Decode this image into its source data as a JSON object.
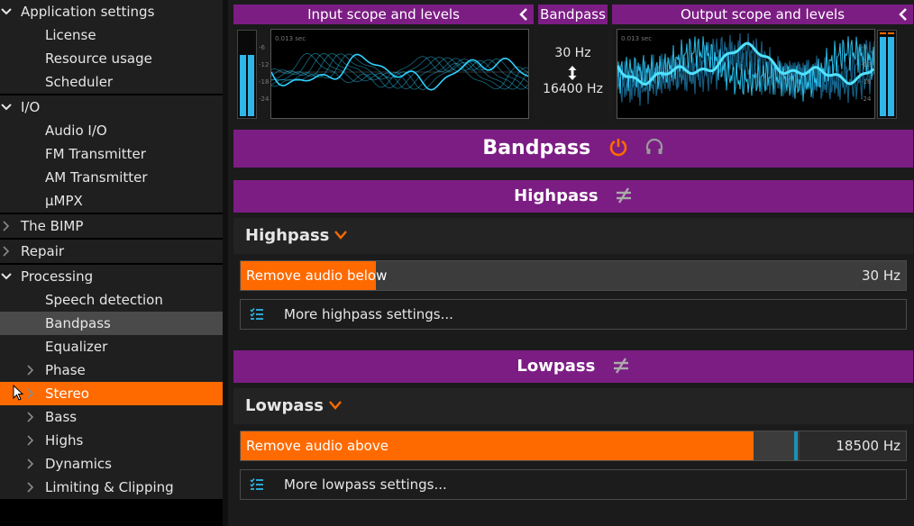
{
  "sidebar": {
    "items": [
      {
        "label": "Application settings",
        "level": 0,
        "chevron": "down"
      },
      {
        "label": "License",
        "level": 1
      },
      {
        "label": "Resource usage",
        "level": 1
      },
      {
        "label": "Scheduler",
        "level": 1
      },
      {
        "label": "I/O",
        "level": 0,
        "chevron": "down"
      },
      {
        "label": "Audio I/O",
        "level": 1
      },
      {
        "label": "FM Transmitter",
        "level": 1
      },
      {
        "label": "AM Transmitter",
        "level": 1
      },
      {
        "label": "μMPX",
        "level": 1
      },
      {
        "label": "The BIMP",
        "level": 0,
        "chevron": "right"
      },
      {
        "label": "Repair",
        "level": 0,
        "chevron": "right"
      },
      {
        "label": "Processing",
        "level": 0,
        "chevron": "down"
      },
      {
        "label": "Speech detection",
        "level": 1
      },
      {
        "label": "Bandpass",
        "level": 1,
        "state": "selected"
      },
      {
        "label": "Equalizer",
        "level": 1
      },
      {
        "label": "Phase",
        "level": 1,
        "chevron": "right"
      },
      {
        "label": "Stereo",
        "level": 1,
        "chevron": "right",
        "state": "active"
      },
      {
        "label": "Bass",
        "level": 1,
        "chevron": "right"
      },
      {
        "label": "Highs",
        "level": 1,
        "chevron": "right"
      },
      {
        "label": "Dynamics",
        "level": 1,
        "chevron": "right"
      },
      {
        "label": "Limiting & Clipping",
        "level": 1,
        "chevron": "right"
      }
    ]
  },
  "scopes": {
    "input_title": "Input scope and levels",
    "output_title": "Output scope and levels",
    "bandpass_title": "Bandpass",
    "time_label": "0.013 sec",
    "db_ticks": [
      "-6",
      "-12",
      "-18",
      "-24"
    ],
    "range_low": "30 Hz",
    "range_high": "16400 Hz"
  },
  "main": {
    "title": "Bandpass",
    "highpass": {
      "bar_title": "Highpass",
      "section_title": "Highpass",
      "slider_label": "Remove audio below",
      "slider_value": "30 Hz",
      "slider_fraction": 0.203,
      "more_label": "More highpass settings..."
    },
    "lowpass": {
      "bar_title": "Lowpass",
      "section_title": "Lowpass",
      "slider_label": "Remove audio above",
      "slider_value": "18500 Hz",
      "slider_fraction": 0.771,
      "more_label": "More lowpass settings..."
    }
  },
  "colors": {
    "accent": "#ff6a00",
    "purple": "#7c1d84",
    "scope_wave": "#2fd0ff"
  },
  "icons": {
    "power": "power-icon",
    "headphones": "headphones-icon",
    "not-equal": "not-equal-icon",
    "chevron-down": "chevron-down-icon",
    "settings-list": "settings-list-icon"
  }
}
